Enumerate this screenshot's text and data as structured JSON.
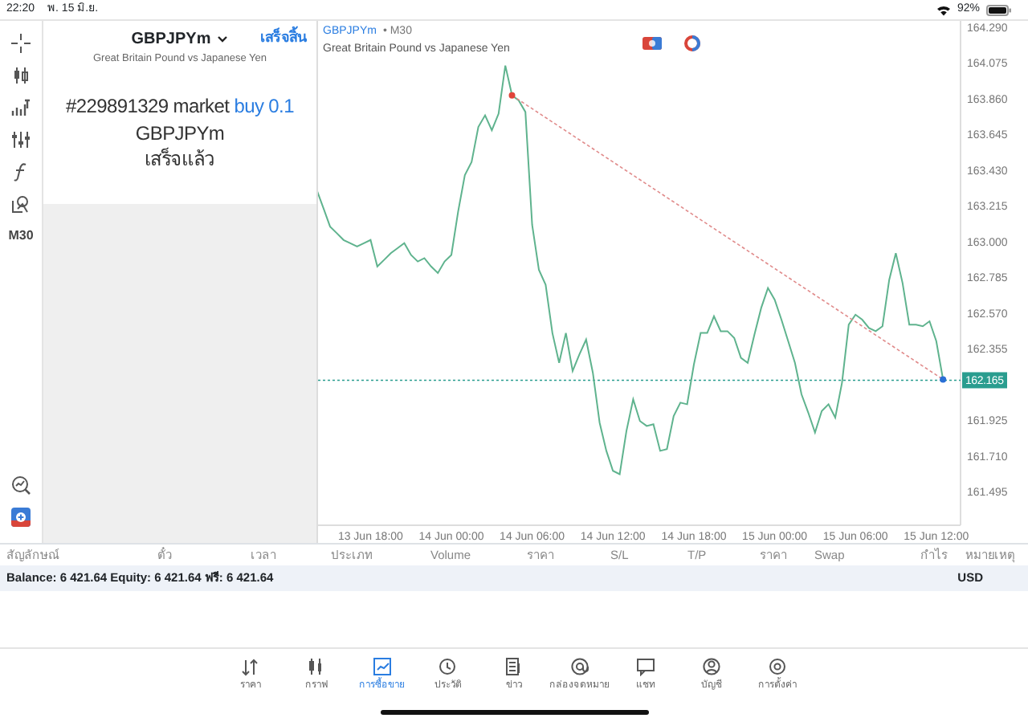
{
  "status_bar": {
    "time": "22:20",
    "date": "พ. 15 มิ.ย.",
    "battery": "92%"
  },
  "toolbar": {
    "timeframe": "M30"
  },
  "order_panel": {
    "symbol": "GBPJPYm",
    "description": "Great Britain Pound vs Japanese Yen",
    "done": "เสร็จสิ้น",
    "order": "#229891329 market",
    "side": "buy 0.1",
    "result_symbol": "GBPJPYm",
    "result": "เสร็จแล้ว"
  },
  "chart": {
    "timeframe": "• M30",
    "description": "Great Britain Pound vs Japanese Yen",
    "chart_data": {
      "type": "line",
      "categories": [
        null,
        null,
        null,
        null,
        null,
        null,
        null,
        null,
        "13 Jun 18:00",
        null,
        null,
        null,
        null,
        null,
        null,
        null,
        null,
        null,
        null,
        null,
        "14 Jun 00:00",
        null,
        null,
        null,
        null,
        null,
        null,
        null,
        null,
        null,
        null,
        null,
        "14 Jun 06:00",
        null,
        null,
        null,
        null,
        null,
        null,
        null,
        null,
        null,
        null,
        null,
        "14 Jun 12:00",
        null,
        null,
        null,
        null,
        null,
        null,
        null,
        null,
        null,
        null,
        null,
        "14 Jun 18:00",
        null,
        null,
        null,
        null,
        null,
        null,
        null,
        null,
        null,
        null,
        null,
        "15 Jun 00:00",
        null,
        null,
        null,
        null,
        null,
        null,
        null,
        null,
        null,
        null,
        null,
        "15 Jun 06:00",
        null,
        null,
        null,
        null,
        null,
        null,
        null,
        null,
        null,
        null,
        null,
        "15 Jun 12:00",
        null
      ],
      "series": [
        {
          "name": "GBPJPYm",
          "color": "#5fb38e",
          "values": [
            163.31,
            163.2,
            163.09,
            163.05,
            163.01,
            162.99,
            162.97,
            162.99,
            163.01,
            162.85,
            162.89,
            162.93,
            162.96,
            162.99,
            162.92,
            162.88,
            162.9,
            162.85,
            162.81,
            162.88,
            162.92,
            163.18,
            163.4,
            163.48,
            163.69,
            163.76,
            163.67,
            163.77,
            164.06,
            163.88,
            163.85,
            163.78,
            163.1,
            162.83,
            162.74,
            162.45,
            162.27,
            162.45,
            162.22,
            162.32,
            162.41,
            162.21,
            161.91,
            161.74,
            161.62,
            161.6,
            161.86,
            162.05,
            161.92,
            161.89,
            161.9,
            161.74,
            161.75,
            161.95,
            162.03,
            162.02,
            162.26,
            162.45,
            162.45,
            162.55,
            162.46,
            162.46,
            162.42,
            162.3,
            162.27,
            162.44,
            162.6,
            162.72,
            162.65,
            162.53,
            162.4,
            162.27,
            162.08,
            161.97,
            161.85,
            161.98,
            162.02,
            161.94,
            162.15,
            162.5,
            162.56,
            162.53,
            162.48,
            162.46,
            162.49,
            162.77,
            162.93,
            162.75,
            162.5,
            162.5,
            162.49,
            162.52,
            162.4,
            162.17
          ]
        }
      ],
      "ylim": [
        161.292,
        164.319
      ],
      "yticks": [
        {
          "value": 164.29,
          "label": "164.290"
        },
        {
          "value": 164.075,
          "label": "164.075"
        },
        {
          "value": 163.86,
          "label": "163.860"
        },
        {
          "value": 163.645,
          "label": "163.645"
        },
        {
          "value": 163.43,
          "label": "163.430"
        },
        {
          "value": 163.215,
          "label": "163.215"
        },
        {
          "value": 163.0,
          "label": "163.000"
        },
        {
          "value": 162.785,
          "label": "162.785"
        },
        {
          "value": 162.57,
          "label": "162.570"
        },
        {
          "value": 162.355,
          "label": "162.355"
        },
        {
          "value": 161.925,
          "label": "161.925"
        },
        {
          "value": 161.71,
          "label": "161.710"
        },
        {
          "value": 161.495,
          "label": "161.495"
        }
      ],
      "ref_lines": [
        {
          "axis": "y",
          "value": 162.165,
          "label": "162.165"
        }
      ]
    }
  },
  "table": {
    "columns": [
      "สัญลักษณ์",
      "ตั๋ว",
      "เวลา",
      "ประเภท",
      "Volume",
      "ราคา",
      "S/L",
      "T/P",
      "ราคา",
      "Swap",
      "กำไร",
      "หมายเหตุ"
    ]
  },
  "summary": {
    "text": "Balance: 6 421.64 Equity: 6 421.64 ฟรี: 6 421.64",
    "currency": "USD"
  },
  "tabs": [
    {
      "label": "ราคา",
      "selected": false
    },
    {
      "label": "กราฟ",
      "selected": false
    },
    {
      "label": "การซื้อขาย",
      "selected": true
    },
    {
      "label": "ประวัติ",
      "selected": false
    },
    {
      "label": "ข่าว",
      "selected": false
    },
    {
      "label": "กล่องจดหมาย",
      "selected": false
    },
    {
      "label": "แชท",
      "selected": false
    },
    {
      "label": "บัญชี",
      "selected": false
    },
    {
      "label": "การตั้งค่า",
      "selected": false
    }
  ]
}
